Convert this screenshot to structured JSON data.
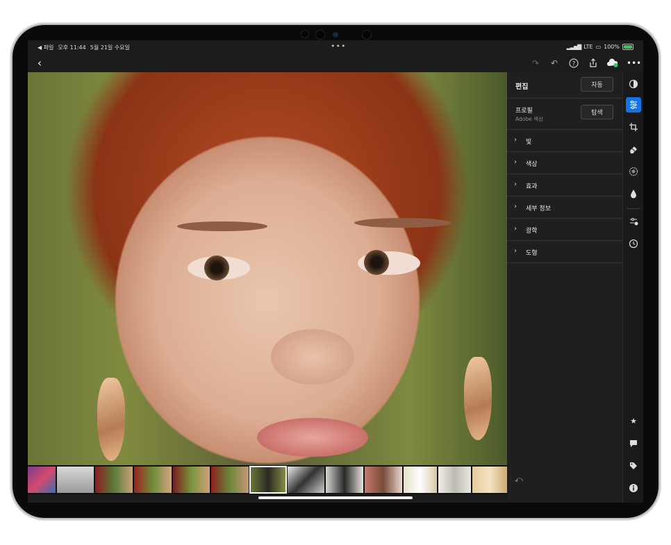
{
  "status": {
    "back_app": "◀ 파일",
    "time": "오후 11:44",
    "date": "5월 21일 수요일",
    "multitask": "•••",
    "network": "LTE",
    "battery": "100%",
    "battery_level": 1.0
  },
  "toolbar": {
    "back_icon": "chevron-left-icon",
    "icons": [
      "redo-icon",
      "undo-icon",
      "help-icon",
      "share-icon",
      "cloud-sync-icon",
      "more-icon"
    ]
  },
  "panel": {
    "title": "편집",
    "auto_label": "자동",
    "profile_label": "프로필",
    "profile_value": "Adobe 색상",
    "browse_label": "탐색",
    "sections": [
      "빛",
      "색상",
      "효과",
      "세부 정보",
      "광학",
      "도형"
    ]
  },
  "rail": {
    "icons": [
      "presets-icon",
      "edit-sliders-icon",
      "crop-icon",
      "healing-icon",
      "masking-icon",
      "blur-icon",
      "versions-icon",
      "history-icon",
      "star-icon",
      "comment-icon",
      "tag-icon",
      "info-icon"
    ],
    "active": "edit-sliders-icon"
  },
  "colors": {
    "accent": "#1473e6",
    "panel_bg": "#1f1f1f",
    "cloud_ok": "#35c759"
  },
  "filmstrip": {
    "count": 13,
    "active_index": 6
  }
}
